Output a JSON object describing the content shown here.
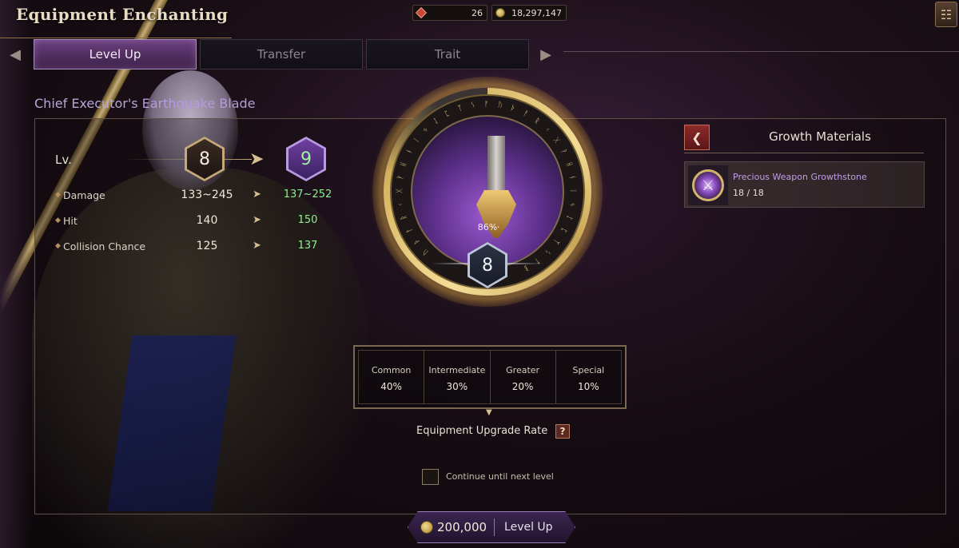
{
  "title": "Equipment Enchanting",
  "currencies": [
    {
      "icon": "red-gem-icon",
      "value": "26"
    },
    {
      "icon": "gold-coin-icon",
      "value": "18,297,147"
    }
  ],
  "tabs": [
    {
      "label": "Level Up",
      "active": true
    },
    {
      "label": "Transfer",
      "active": false
    },
    {
      "label": "Trait",
      "active": false
    }
  ],
  "item": {
    "name_prefix": "Chief Executor's ",
    "name_highlight": "Earthquake Blade"
  },
  "level": {
    "label": "Lv.",
    "current": "8",
    "next": "9"
  },
  "stats": [
    {
      "label": "Damage",
      "current": "133~245",
      "next": "137~252"
    },
    {
      "label": "Hit",
      "current": "140",
      "next": "150"
    },
    {
      "label": "Collision Chance",
      "current": "125",
      "next": "137"
    }
  ],
  "enchant_ring": {
    "progress_text": "86%",
    "progress": 0.86,
    "level": "8",
    "more_indicator": "..."
  },
  "growth_materials": {
    "title": "Growth Materials",
    "items": [
      {
        "name": "Precious Weapon Growthstone",
        "count": "18 / 18"
      }
    ]
  },
  "upgrade_rates": [
    {
      "label": "Common",
      "value": "40%"
    },
    {
      "label": "Intermediate",
      "value": "30%"
    },
    {
      "label": "Greater",
      "value": "20%"
    },
    {
      "label": "Special",
      "value": "10%"
    }
  ],
  "upgrade_rate_label": "Equipment Upgrade Rate",
  "help_symbol": "?",
  "continue_label": "Continue until next level",
  "level_up_button": {
    "cost": "200,000",
    "label": "Level Up"
  },
  "colors": {
    "accent_purple": "#6a3f7e",
    "gold": "#d9bb6c",
    "increase_green": "#8ff08f",
    "item_name_purple": "#b39bdc"
  }
}
